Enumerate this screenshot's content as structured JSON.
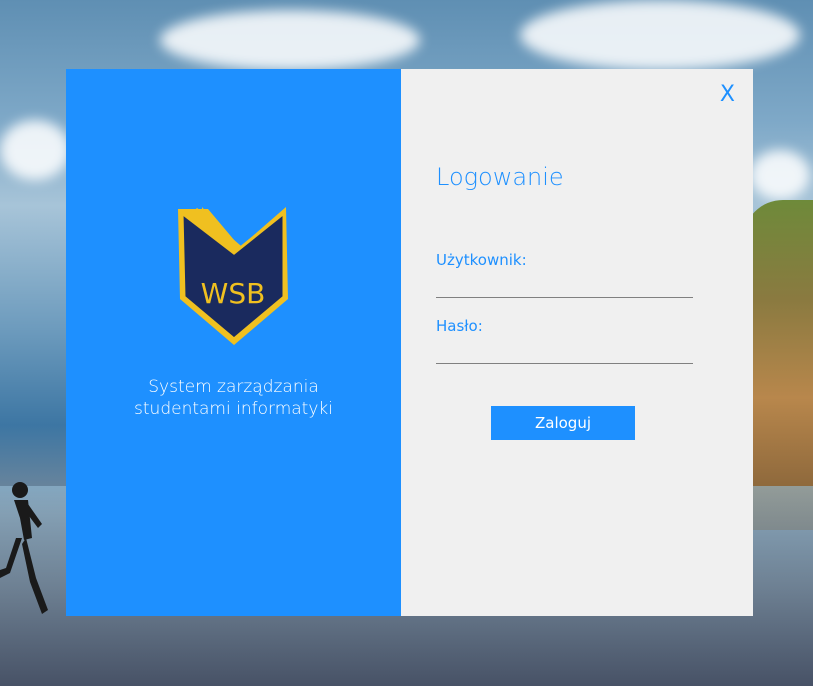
{
  "window": {
    "close_label": "X"
  },
  "branding": {
    "logo_text": "WSB",
    "subtitle_line1": "System zarządzania",
    "subtitle_line2": "studentami informatyki"
  },
  "login_form": {
    "title": "Logowanie",
    "username_label": "Użytkownik:",
    "username_value": "",
    "password_label": "Hasło:",
    "password_value": "",
    "submit_label": "Zaloguj"
  },
  "colors": {
    "accent": "#1e90ff",
    "panel_background": "#f0f0f0",
    "logo_navy": "#1a2a5e",
    "logo_gold": "#f0c020"
  },
  "icons": {
    "logo": "wsb-shield-book-logo",
    "close": "close-icon"
  }
}
